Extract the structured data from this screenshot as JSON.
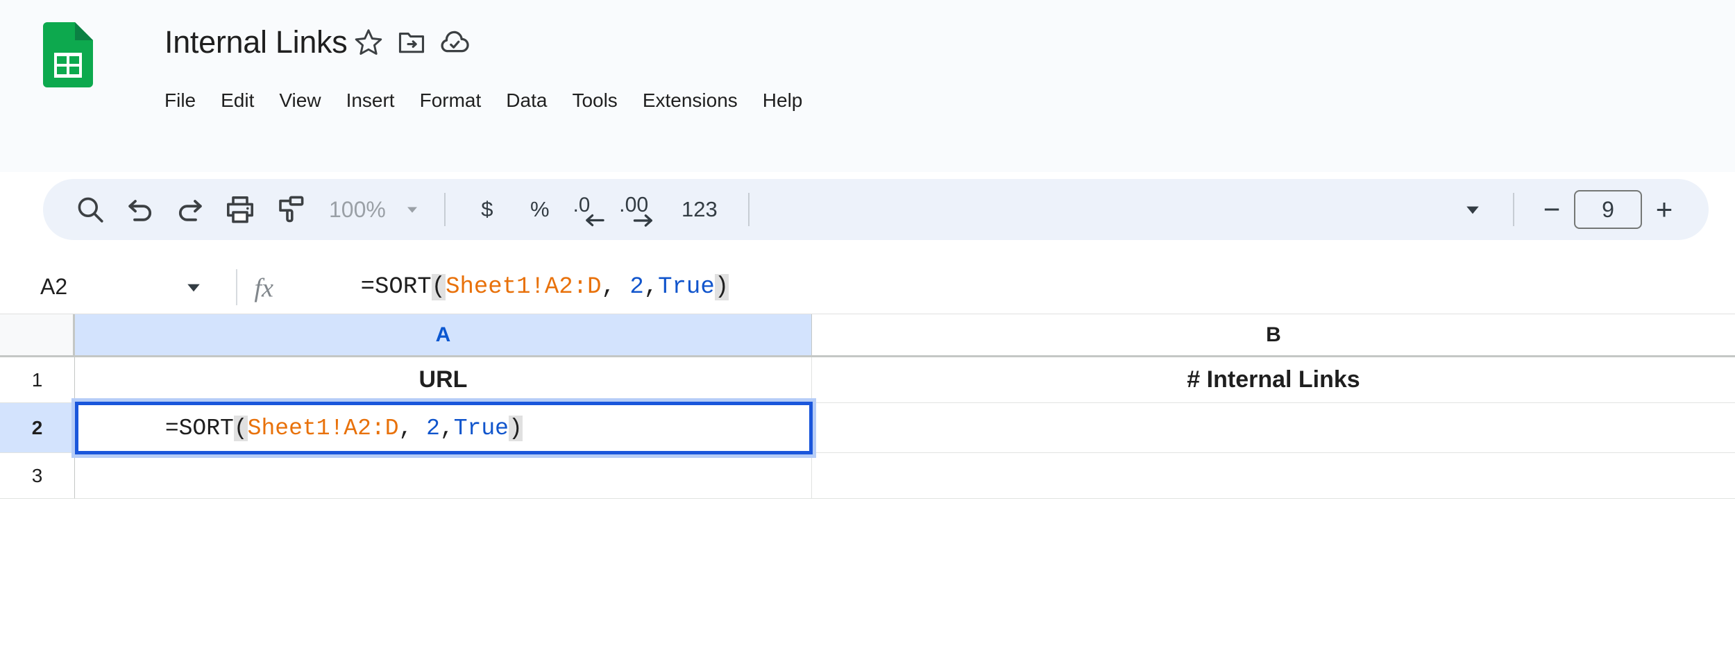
{
  "app": {
    "name": "Google Sheets",
    "logo_color": "#0DA94E",
    "logo_fold_color": "#0B8043",
    "accent_color": "#1A56DB",
    "selection_halo_color": "#B6CDF7",
    "header_bg": "#F9FBFD",
    "toolbar_bg": "#EDF2FA",
    "header_sel_bg": "#D3E3FD"
  },
  "header": {
    "doc_title": "Internal Links",
    "icons": [
      {
        "name": "star-icon",
        "label": "Star"
      },
      {
        "name": "move-to-folder-icon",
        "label": "Move"
      },
      {
        "name": "drive-cloud-icon",
        "label": "Saved to Drive"
      }
    ],
    "menu": [
      {
        "label": "File"
      },
      {
        "label": "Edit"
      },
      {
        "label": "View"
      },
      {
        "label": "Insert"
      },
      {
        "label": "Format"
      },
      {
        "label": "Data"
      },
      {
        "label": "Tools"
      },
      {
        "label": "Extensions"
      },
      {
        "label": "Help"
      }
    ]
  },
  "toolbar": {
    "search_icon": "search-icon",
    "undo_icon": "undo-icon",
    "redo_icon": "redo-icon",
    "print_icon": "print-icon",
    "paint_format_icon": "paint-format-icon",
    "zoom_value": "100%",
    "zoom_caret": "▾",
    "currency_label": "$",
    "percent_label": "%",
    "decrease_decimal_label": ".0",
    "decrease_decimal_arrow": "←",
    "increase_decimal_label": ".00",
    "increase_decimal_arrow": "→",
    "number_format_label": "123",
    "more_caret": "▾",
    "font_size_value": "9",
    "font_size_decrease": "−",
    "font_size_increase": "+"
  },
  "formula_bar": {
    "name_box_value": "A2",
    "name_box_caret": "▾",
    "fx_label": "fx",
    "formula_raw": "=SORT(Sheet1!A2:D, 2,True)",
    "tokens": [
      {
        "text": "=SORT",
        "kind": "fn"
      },
      {
        "text": "(",
        "kind": "paren"
      },
      {
        "text": "Sheet1!A2:D",
        "kind": "ref"
      },
      {
        "text": ", ",
        "kind": "plain"
      },
      {
        "text": "2",
        "kind": "num"
      },
      {
        "text": ",",
        "kind": "plain"
      },
      {
        "text": "True",
        "kind": "bool"
      },
      {
        "text": ")",
        "kind": "paren"
      }
    ],
    "token_colors": {
      "ref": "#E8710A",
      "num": "#1155CC",
      "bool": "#1155CC",
      "fn": "#1f1f1f",
      "paren_bg": "#e0e0e0"
    }
  },
  "grid": {
    "columns": [
      {
        "label": "A",
        "selected": true
      },
      {
        "label": "B",
        "selected": false
      }
    ],
    "rows": [
      {
        "label": "1",
        "selected": false
      },
      {
        "label": "2",
        "selected": true
      },
      {
        "label": "3",
        "selected": false
      }
    ],
    "cells": {
      "A1": "URL",
      "B1": "# Internal Links",
      "A2": "=SORT(Sheet1!A2:D, 2,True)",
      "B2": "",
      "A3": "",
      "B3": ""
    },
    "active_cell": "A2",
    "editing": true
  }
}
